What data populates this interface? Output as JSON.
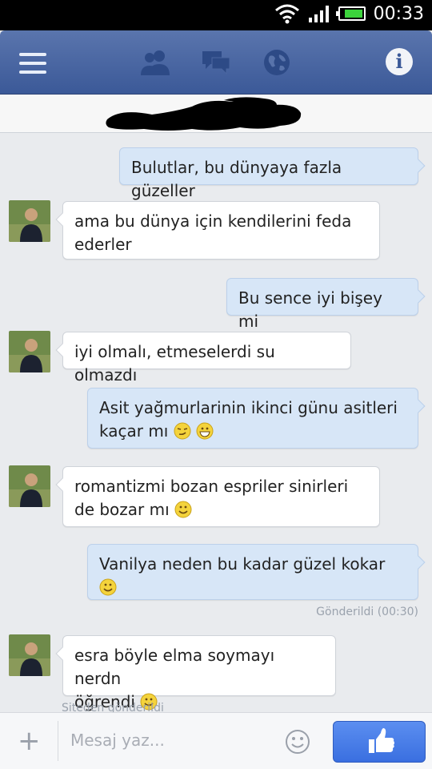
{
  "status": {
    "time": "00:33",
    "battery_level": 0.85,
    "icons": [
      "wifi-icon",
      "signal-icon",
      "battery-icon"
    ]
  },
  "header": {
    "icons": [
      "menu-icon",
      "friends-icon",
      "messages-icon",
      "globe-icon",
      "info-icon"
    ],
    "color": "#3b5998"
  },
  "messages": [
    {
      "type": "sent",
      "text": "Bulutlar, bu dünyaya fazla güzeller"
    },
    {
      "type": "recv",
      "text": "ama bu dünya için kendilerini feda ederler"
    },
    {
      "type": "sent",
      "text": "Bu sence iyi bişey mi"
    },
    {
      "type": "recv",
      "text": "iyi olmalı, etmeselerdi su olmazdı"
    },
    {
      "type": "sent",
      "line1": "Asit yağmurlarinin ikinci günu asitleri",
      "line2": "kaçar mı",
      "emojis": [
        "smirk-emoji",
        "grin-emoji"
      ]
    },
    {
      "type": "recv",
      "line1": "romantizmi bozan espriler sinirleri",
      "line2": "de bozar mı",
      "emojis": [
        "smile-emoji"
      ]
    },
    {
      "type": "sent",
      "text": "Vanilya neden bu kadar güzel kokar",
      "emojis": [
        "smile-emoji"
      ]
    },
    {
      "type": "recv",
      "line1": "esra böyle elma soymayı nerdn",
      "line2": "öğrendi",
      "emojis": [
        "smile-emoji"
      ]
    }
  ],
  "sent_status": "Gönderildi (00:30)",
  "via": "Siteden gönderildi",
  "composer": {
    "placeholder": "Mesaj yaz..."
  },
  "colors": {
    "sent_bubble": "#d7e6f7",
    "recv_bubble": "#ffffff",
    "like_button": "#3a6fe0"
  }
}
